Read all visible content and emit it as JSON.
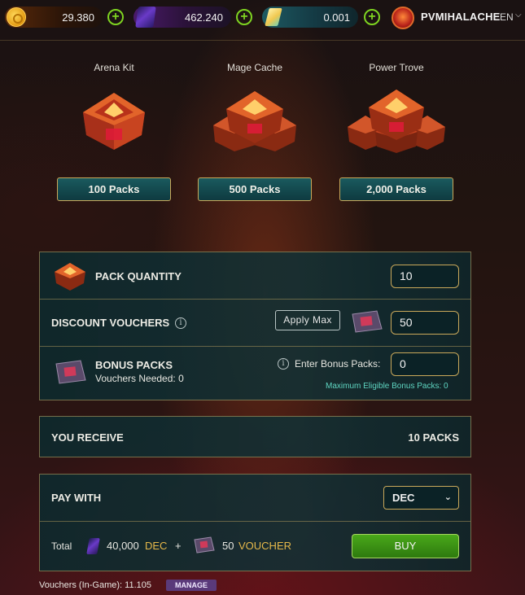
{
  "topbar": {
    "credits": {
      "value": "29.380",
      "icon": "credits-coin-icon"
    },
    "dec": {
      "value": "462.240",
      "icon": "dec-gem-icon"
    },
    "sps": {
      "value": "0.001",
      "icon": "sps-shard-icon"
    },
    "plus_symbol": "+",
    "username": "PVMIHALACHE",
    "language": "EN",
    "language_caret": "⌵"
  },
  "options": [
    {
      "title": "Arena Kit",
      "button": "100 Packs"
    },
    {
      "title": "Mage Cache",
      "button": "500 Packs"
    },
    {
      "title": "Power Trove",
      "button": "2,000 Packs"
    }
  ],
  "purchase": {
    "pack_quantity": {
      "label": "PACK QUANTITY",
      "value": "10"
    },
    "discount_vouchers": {
      "label": "DISCOUNT VOUCHERS",
      "info": "i",
      "apply_max": "Apply Max",
      "value": "50"
    },
    "bonus_packs": {
      "label": "BONUS PACKS",
      "vouchers_needed": "Vouchers Needed: 0",
      "info": "i",
      "enter_label": "Enter Bonus Packs:",
      "value": "0",
      "max_eligible": "Maximum Eligible Bonus Packs: 0"
    }
  },
  "receive": {
    "label": "YOU RECEIVE",
    "value": "10 PACKS"
  },
  "pay": {
    "label": "PAY WITH",
    "currency": "DEC",
    "caret": "⌄",
    "total_label": "Total",
    "dec_amount": "40,000",
    "dec_unit": "DEC",
    "plus": "+",
    "voucher_amount": "50",
    "voucher_unit": "VOUCHER",
    "buy": "BUY"
  },
  "footer": {
    "vouchers": "Vouchers (In-Game): 11.105",
    "manage": "MANAGE"
  },
  "colors": {
    "accent_gold": "#c9a85a",
    "teal_panel": "#12303a",
    "buy_green": "#3a9414",
    "plus_green": "#7ed321",
    "teal_text": "#5fd6c2"
  }
}
